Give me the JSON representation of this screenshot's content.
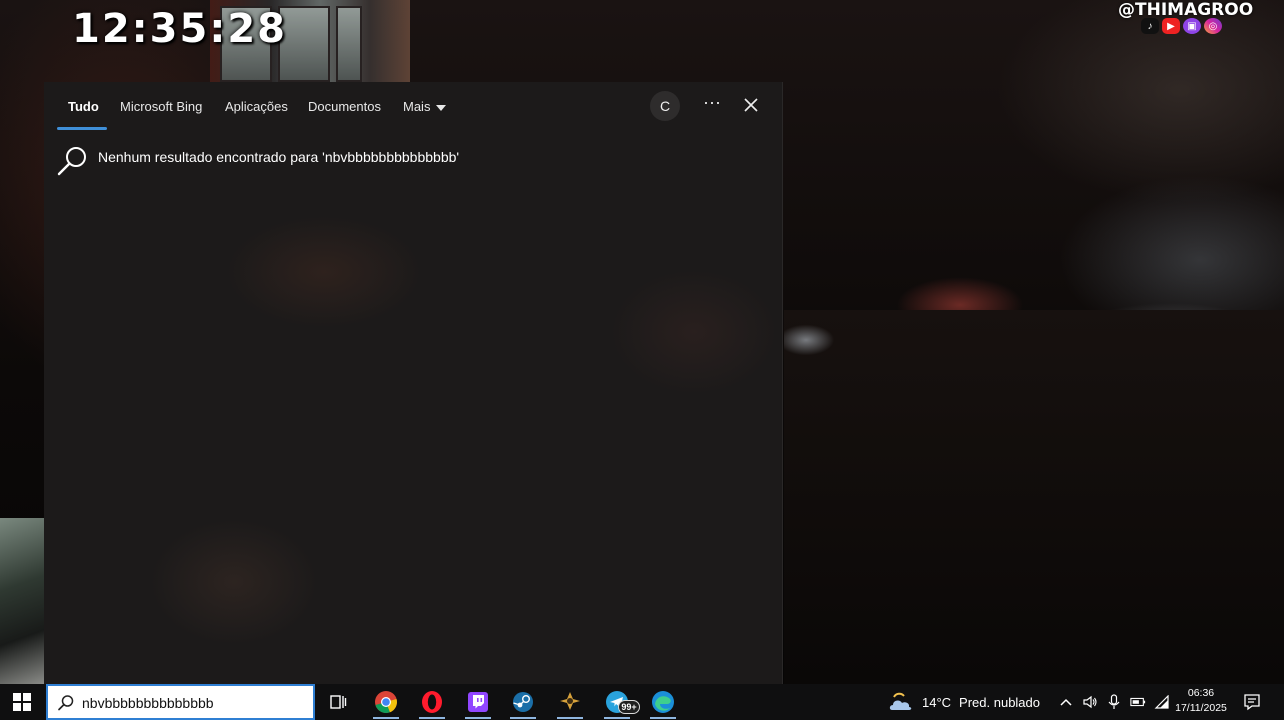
{
  "overlay": {
    "clock": "12:35:28",
    "handle": "@THIMAGROO",
    "social_icons": [
      "tiktok-icon",
      "youtube-icon",
      "twitch-icon",
      "instagram-icon"
    ]
  },
  "search_panel": {
    "tabs": [
      {
        "label": "Tudo",
        "active": true
      },
      {
        "label": "Microsoft Bing"
      },
      {
        "label": "Aplicações"
      },
      {
        "label": "Documentos"
      },
      {
        "label": "Mais"
      }
    ],
    "account_initial": "C",
    "more_label": "···",
    "no_results_text": "Nenhum resultado encontrado para 'nbvbbbbbbbbbbbbbb'"
  },
  "taskbar": {
    "search_value": "nbvbbbbbbbbbbbbbb",
    "apps": [
      "task-view-icon",
      "chrome-icon",
      "opera-icon",
      "twitch-icon",
      "steam-icon",
      "game-launcher-icon",
      "telegram-icon",
      "edge-icon"
    ],
    "telegram_badge": "99+",
    "weather": {
      "temp": "14°C",
      "condition": "Pred. nublado"
    },
    "time": "06:36",
    "date": "17/11/2025"
  },
  "colors": {
    "accent": "#3f8fd8",
    "panel_bg": "#1c1a1a",
    "taskbar_bg": "#0f0f10"
  }
}
